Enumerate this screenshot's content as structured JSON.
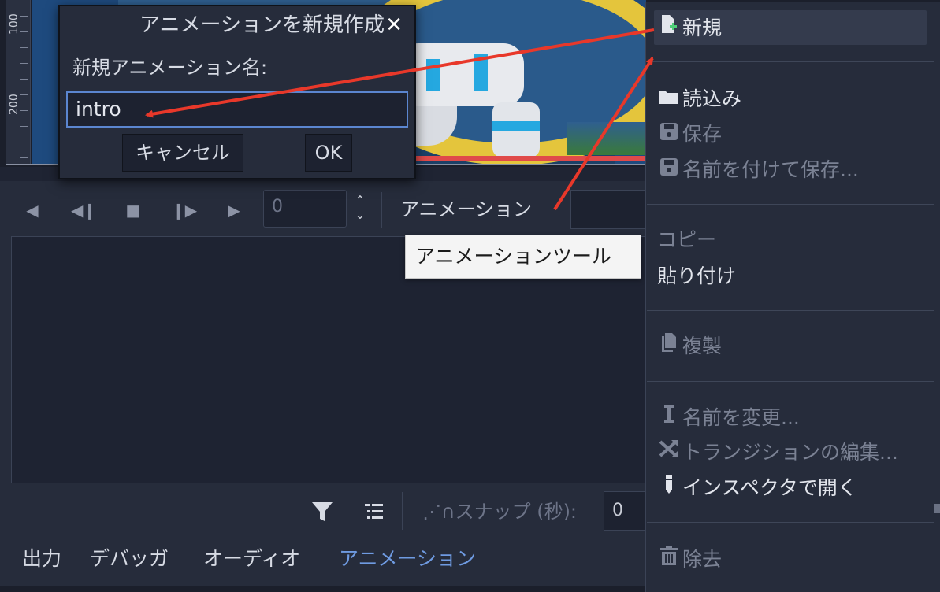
{
  "ruler": {
    "labels": [
      "100",
      "200"
    ]
  },
  "dialog": {
    "title": "アニメーションを新規作成",
    "close_glyph": "✕",
    "name_label": "新規アニメーション名:",
    "name_value": "intro",
    "cancel_label": "キャンセル",
    "ok_label": "OK"
  },
  "toolbar": {
    "frame_value": "0",
    "animation_menu_label": "アニメーション"
  },
  "tooltip": {
    "text": "アニメーションツール"
  },
  "menu": {
    "new": "新規",
    "load": "読込み",
    "save": "保存",
    "save_as": "名前を付けて保存...",
    "copy": "コピー",
    "paste": "貼り付け",
    "duplicate": "複製",
    "rename": "名前を変更...",
    "edit_transitions": "トランジションの編集...",
    "open_in_inspector": "インスペクタで開く",
    "remove": "除去"
  },
  "snap": {
    "label": "スナップ (秒):",
    "value": "0"
  },
  "bottom_tabs": [
    "出力",
    "デバッガ",
    "オーディオ",
    "アニメーション"
  ],
  "colors": {
    "accent": "#6f9be2",
    "arrow": "#e8382a",
    "gear": "#e4c53c"
  }
}
